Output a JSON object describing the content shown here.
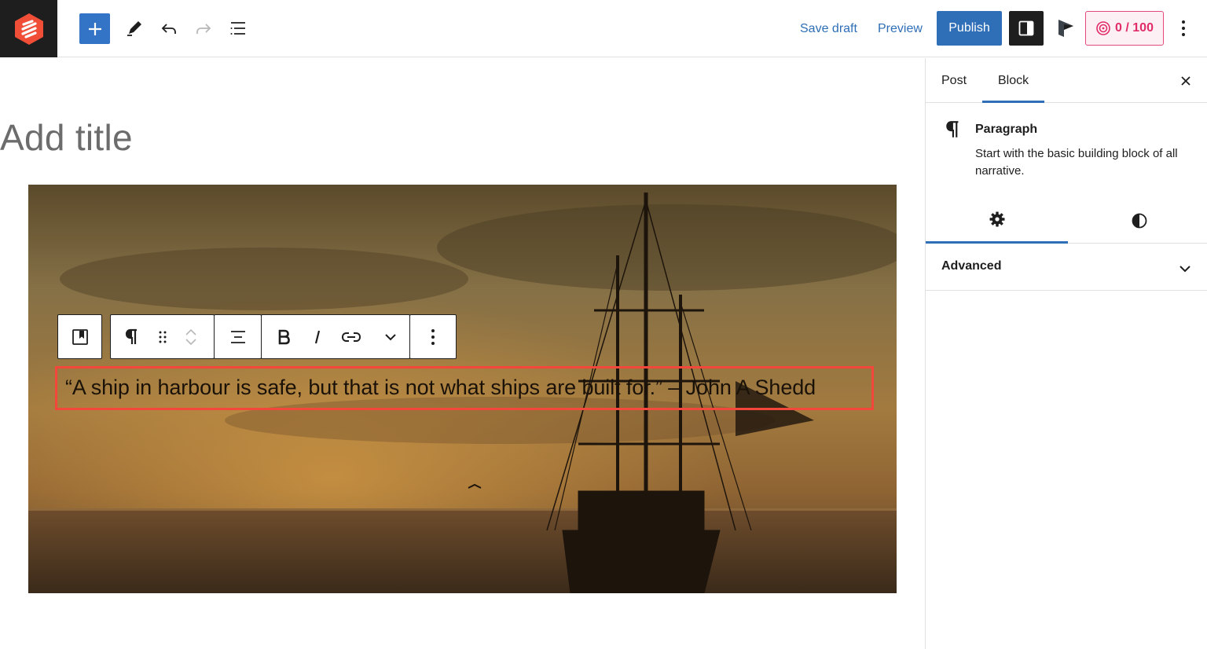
{
  "topbar": {
    "save_draft": "Save draft",
    "preview": "Preview",
    "publish": "Publish",
    "score": "0 / 100"
  },
  "editor": {
    "title_placeholder": "Add title",
    "quote": "“A ship in harbour is safe, but that is not what ships are built for.” – John A Shedd"
  },
  "sidebar": {
    "tabs": [
      {
        "label": "Post",
        "active": false
      },
      {
        "label": "Block",
        "active": true
      }
    ],
    "block": {
      "name": "Paragraph",
      "description": "Start with the basic building block of all narrative."
    },
    "sub_tabs": [
      {
        "icon": "gear-icon",
        "active": true
      },
      {
        "icon": "contrast-icon",
        "active": false
      }
    ],
    "advanced_label": "Advanced"
  },
  "colors": {
    "accent": "#2f6fb7",
    "add_button": "#3474c6",
    "score_border": "#e5497a",
    "selection_outline": "#f2473a"
  }
}
